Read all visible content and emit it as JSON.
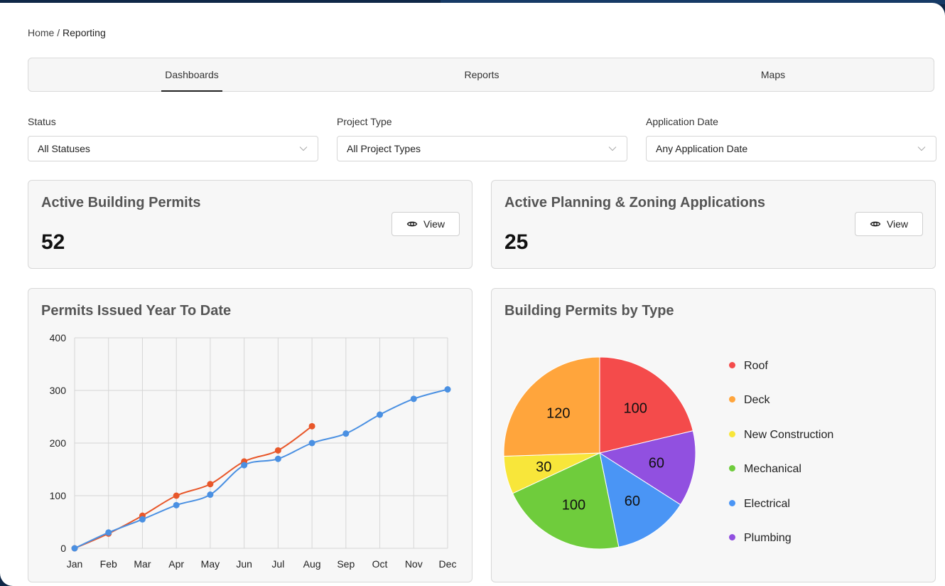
{
  "breadcrumb": {
    "home": "Home",
    "separator": "/",
    "current": "Reporting"
  },
  "tabs": [
    {
      "label": "Dashboards",
      "active": true
    },
    {
      "label": "Reports",
      "active": false
    },
    {
      "label": "Maps",
      "active": false
    }
  ],
  "filters": [
    {
      "label": "Status",
      "value": "All Statuses"
    },
    {
      "label": "Project Type",
      "value": "All Project Types"
    },
    {
      "label": "Application Date",
      "value": "Any Application Date"
    }
  ],
  "cards": {
    "permits": {
      "title": "Active Building Permits",
      "value": "52",
      "button": "View"
    },
    "planning": {
      "title": "Active Planning & Zoning Applications",
      "value": "25",
      "button": "View"
    }
  },
  "colors": {
    "accent": "#222222",
    "navy": "#0f2747",
    "series_orange": "#e8572a",
    "series_blue": "#4a90e2"
  },
  "chart_data": [
    {
      "type": "line",
      "title": "Permits Issued Year To Date",
      "categories": [
        "Jan",
        "Feb",
        "Mar",
        "Apr",
        "May",
        "Jun",
        "Jul",
        "Aug",
        "Sep",
        "Oct",
        "Nov",
        "Dec"
      ],
      "series": [
        {
          "values": [
            0,
            28,
            62,
            100,
            122,
            165,
            186,
            232,
            null,
            null,
            null,
            null
          ],
          "color": "#e8572a"
        },
        {
          "values": [
            0,
            30,
            55,
            82,
            102,
            158,
            170,
            200,
            218,
            254,
            284,
            302
          ],
          "color": "#4a90e2"
        }
      ],
      "yticks": [
        0,
        100,
        200,
        300,
        400
      ],
      "ylim": [
        0,
        400
      ],
      "grid": true
    },
    {
      "type": "pie",
      "title": "Building Permits by Type",
      "labels": [
        "Roof",
        "Plumbing",
        "Electrical",
        "Mechanical",
        "New Construction",
        "Deck"
      ],
      "values": [
        100,
        60,
        60,
        100,
        30,
        120
      ],
      "colors": [
        "#f44b4b",
        "#9150e0",
        "#4a95f5",
        "#6fcc3c",
        "#f8e63a",
        "#ffa53c"
      ],
      "legend": [
        {
          "label": "Roof",
          "color": "#f44b4b"
        },
        {
          "label": "Deck",
          "color": "#ffa53c"
        },
        {
          "label": "New Construction",
          "color": "#f8e63a"
        },
        {
          "label": "Mechanical",
          "color": "#6fcc3c"
        },
        {
          "label": "Electrical",
          "color": "#4a95f5"
        },
        {
          "label": "Plumbing",
          "color": "#9150e0"
        }
      ],
      "legend_position": "right"
    }
  ]
}
